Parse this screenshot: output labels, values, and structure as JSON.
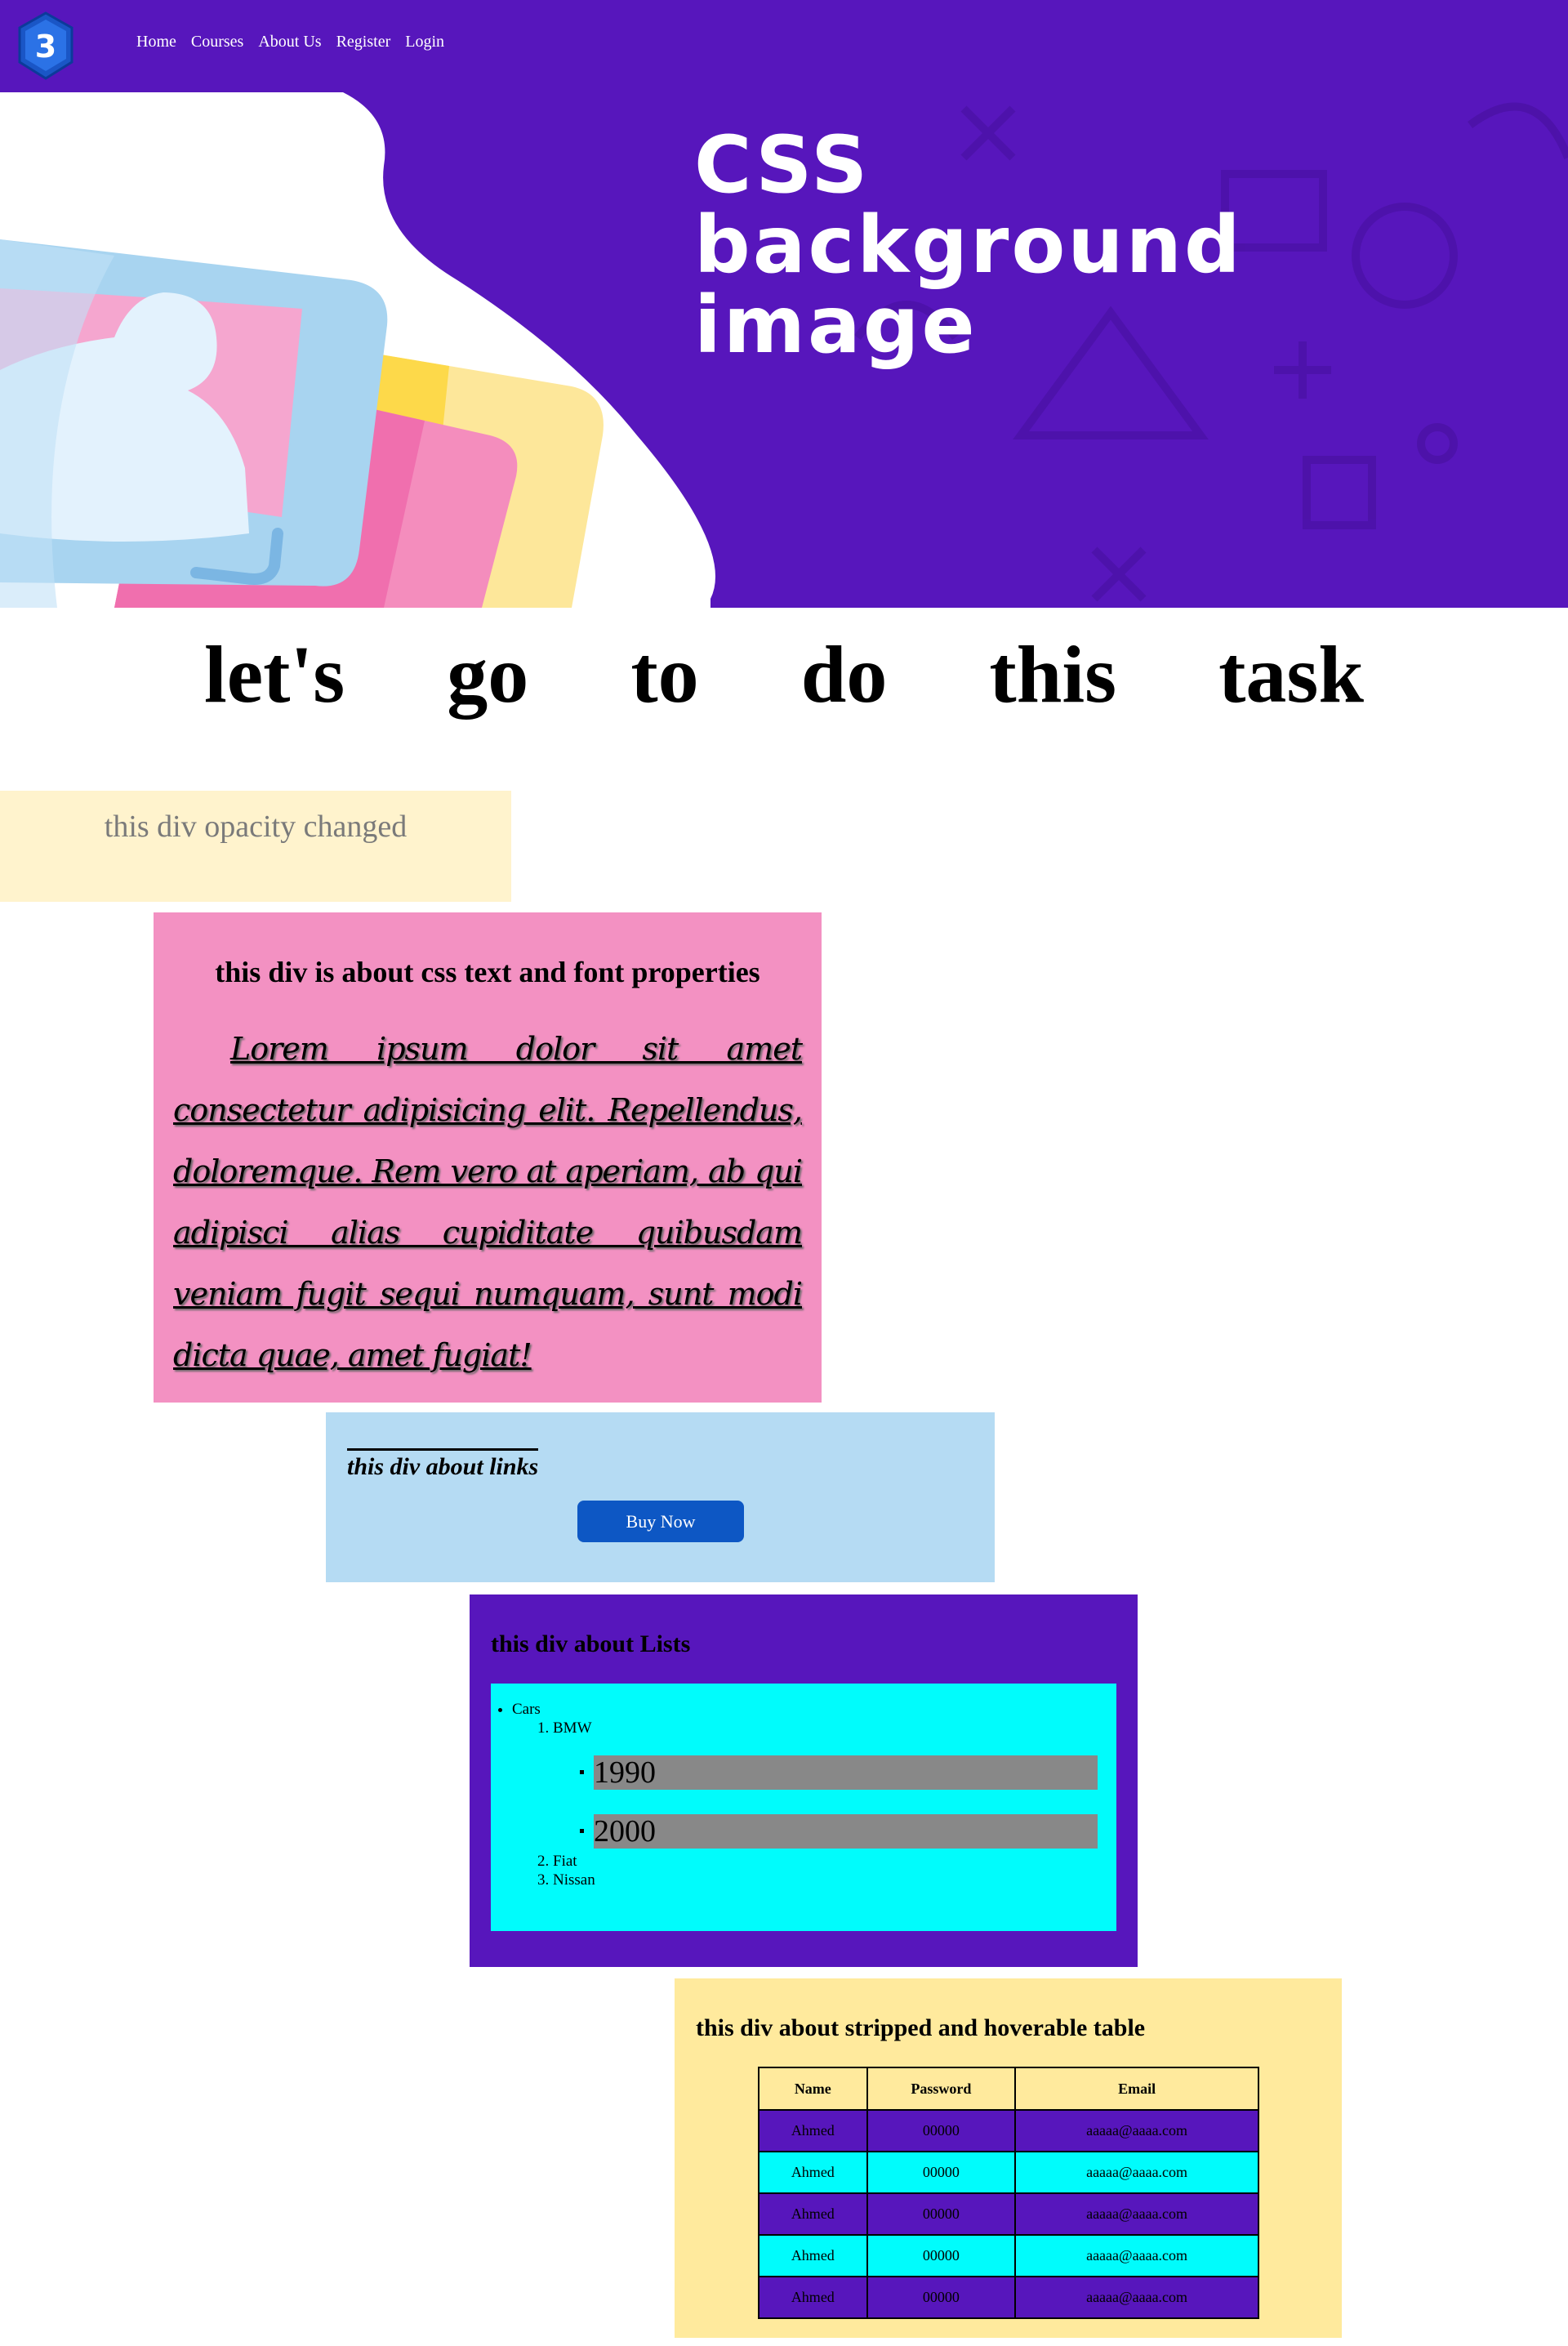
{
  "nav": {
    "links": [
      "Home",
      "Courses",
      "About Us",
      "Register",
      "Login"
    ]
  },
  "hero": {
    "title_lines": [
      "CSS",
      "background",
      "image"
    ]
  },
  "heading": {
    "words": [
      "let's",
      "go",
      "to",
      "do",
      "this",
      "task"
    ]
  },
  "opacity_section": {
    "text": "this div opacity changed"
  },
  "text_section": {
    "title": "this div is about css text and font properties",
    "paragraph": "Lorem ipsum dolor sit amet consectetur adipisicing elit. Repellendus, doloremque. Rem vero at aperiam, ab qui adipisci alias cupiditate quibusdam veniam fugit sequi numquam, sunt modi dicta quae, amet fugiat!"
  },
  "links_section": {
    "title": "this div about links",
    "button_label": "Buy Now"
  },
  "lists_section": {
    "title": "this div about Lists",
    "outer_item": "Cars",
    "brands": [
      "BMW",
      "Fiat",
      "Nissan"
    ],
    "years": [
      "1990",
      "2000"
    ]
  },
  "table_section": {
    "title": "this div about stripped and hoverable table",
    "headers": [
      "Name",
      "Password",
      "Email"
    ],
    "rows": [
      [
        "Ahmed",
        "00000",
        "aaaaa@aaaa.com"
      ],
      [
        "Ahmed",
        "00000",
        "aaaaa@aaaa.com"
      ],
      [
        "Ahmed",
        "00000",
        "aaaaa@aaaa.com"
      ],
      [
        "Ahmed",
        "00000",
        "aaaaa@aaaa.com"
      ],
      [
        "Ahmed",
        "00000",
        "aaaaa@aaaa.com"
      ]
    ]
  },
  "colors": {
    "brand_purple": "#5716bc",
    "cyan": "#00fcfc",
    "pink": "#f391c2",
    "light_blue": "#b5dbf3",
    "light_yellow": "#ffea9d",
    "button_blue": "#0d57c4"
  },
  "icons": {
    "logo": "css3-logo-icon"
  }
}
